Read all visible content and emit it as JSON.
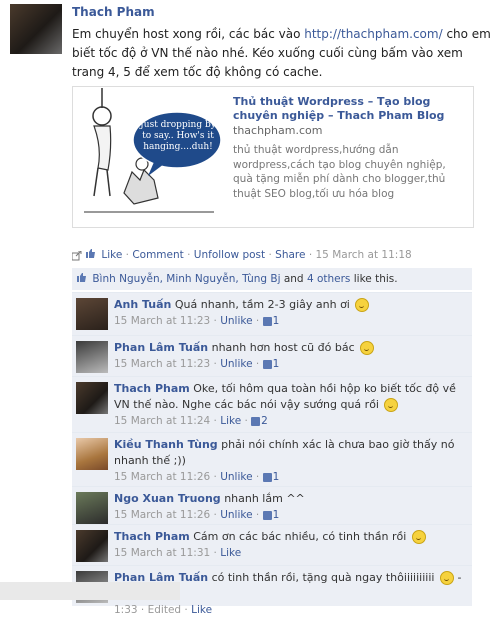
{
  "post": {
    "author": "Thach Pham",
    "message_before_link": "Em chuyển host xong rồi, các bác vào ",
    "message_link": "http://thachpham.com/",
    "message_after_link": " cho em biết tốc độ ở VN thế nào nhé. Kéo xuống cuối cùng bấm vào xem trang 4, 5 để xem tốc độ không có cache.",
    "attachment": {
      "title": "Thủ thuật Wordpress – Tạo blog chuyên nghiệp – Thach Pham Blog",
      "domain": "thachpham.com",
      "description": "thủ thuật wordpress,hướng dẫn wordpress,cách tạo blog chuyên nghiệp, quà tặng miễn phí dành cho blogger,thủ thuật SEO blog,tối ưu hóa blog",
      "image_caption": "Just dropping by to say.. How's it hanging....duh!"
    },
    "actions": {
      "like": "Like",
      "sep": "·",
      "comment": "Comment",
      "unfollow": "Unfollow post",
      "share": "Share",
      "timestamp": "15 March at 11:18"
    }
  },
  "likes": {
    "names": "Bình Nguyễn, Minh Nguyễn, Tùng Bj",
    "and_text": " and ",
    "others": "4 others",
    "suffix": " like this."
  },
  "comments": [
    {
      "name": "Anh Tuấn",
      "text": "Quá nhanh, tầm 2-3 giây anh ơi",
      "smiley": true,
      "time": "15 March at 11:23",
      "action": "Unlike",
      "likes": "1"
    },
    {
      "name": "Phan Lâm Tuấn",
      "text": "nhanh hơn host cũ đó bác",
      "smiley": true,
      "time": "15 March at 11:23",
      "action": "Unlike",
      "likes": "1"
    },
    {
      "name": "Thach Pham",
      "text": "Oke, tối hôm qua toàn hồi hộp ko biết tốc độ về VN thế nào. Nghe các bác nói vậy sướng quá rồi",
      "smiley": true,
      "time": "15 March at 11:24",
      "action": "Like",
      "likes": "2"
    },
    {
      "name": "Kiều Thanh Tùng",
      "text": "phải nói chính xác là chưa bao giờ thấy nó nhanh thế ;))",
      "smiley": false,
      "time": "15 March at 11:26",
      "action": "Unlike",
      "likes": "1"
    },
    {
      "name": "Ngo Xuan Truong",
      "text": "nhanh lắm ^^",
      "smiley": false,
      "time": "15 March at 11:26",
      "action": "Unlike",
      "likes": "1"
    },
    {
      "name": "Thach Pham",
      "text": "Cám ơn các bác nhiều, có tinh thần rồi",
      "smiley": true,
      "time": "15 March at 11:31",
      "action": "Like",
      "likes": ""
    },
    {
      "name": "Phan Lâm Tuấn",
      "text": "có tinh thần rồi, tặng quà ngay thôiiiiiiiiii",
      "smiley": true,
      "text_after": " ---",
      "time": "1:33",
      "edited": "Edited",
      "action": "Like",
      "likes": ""
    }
  ]
}
